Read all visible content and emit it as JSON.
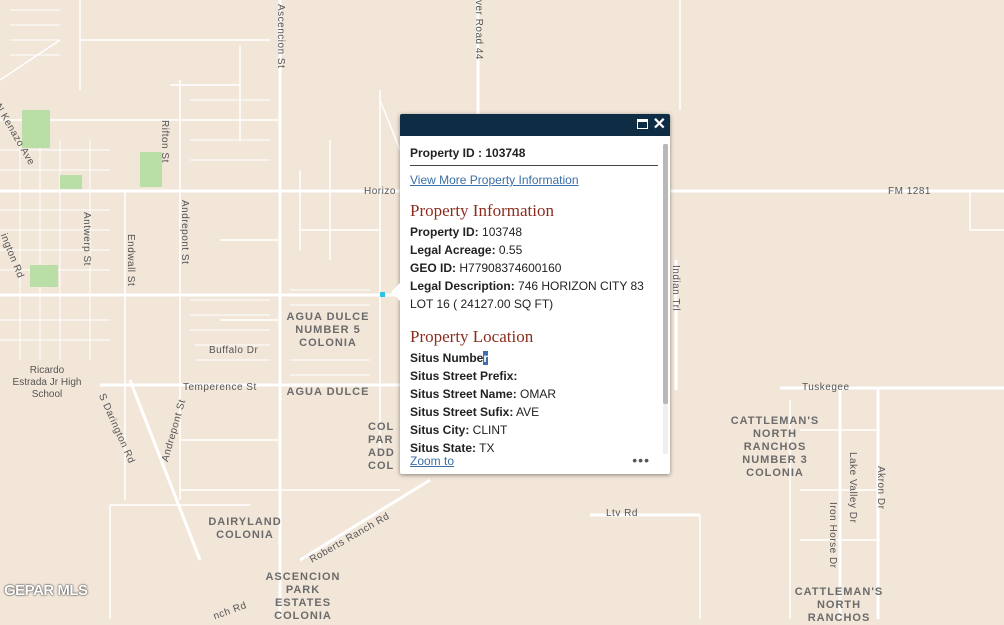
{
  "map": {
    "road_labels": {
      "ascencion_st": "Ascencion St",
      "river_road": "ver Road 44",
      "n_kenazo": "N Kenazo Ave",
      "rifton": "Rifton St",
      "horizon": "Horizo",
      "fm1281": "FM 1281",
      "antwerp": "Antwerp St",
      "endwall": "Endwall St",
      "andrepont": "Andrepont St",
      "darington_rd": "ington Rd",
      "buffalo": "Buffalo Dr",
      "temperence": "Temperence St",
      "s_darington": "S Darington Rd",
      "andrepont2": "Andrepont St",
      "indian": "Indian Trl",
      "tuskegee": "Tuskegee",
      "ltv": "Ltv Rd",
      "roberts": "Roberts Ranch Rd",
      "lake_valley": "Lake Valley Dr",
      "akron": "Akron Dr",
      "iron_horse": "Iron Horse Dr",
      "bottom_rd": "nch Rd"
    },
    "area_labels": {
      "agua_dulce5": "AGUA DULCE\nNUMBER 5\nCOLONIA",
      "agua_dulce": "AGUA DULCE",
      "school": "Ricardo\nEstrada Jr High\nSchool",
      "cattleman3": "CATTLEMAN'S\nNORTH\nRANCHOS\nNUMBER 3\nCOLONIA",
      "dairyland": "DAIRYLAND\nCOLONIA",
      "ascencion_park": "ASCENCION\nPARK\nESTATES\nCOLONIA",
      "cattleman_n": "CATTLEMAN'S\nNORTH\nRANCHOS",
      "partial": "COL\nPAR\nADD\nCOL"
    },
    "watermark": "GEPAR MLS"
  },
  "popup": {
    "title": "Property ID : 103748",
    "more_link": "View More Property Information",
    "info_section": {
      "heading": "Property Information",
      "rows": [
        {
          "label": "Property ID:",
          "value": " 103748"
        },
        {
          "label": "Legal Acreage:",
          "value": " 0.55"
        },
        {
          "label": "GEO ID:",
          "value": " H77908374600160"
        },
        {
          "label": "Legal Description:",
          "value": " 746 HORIZON CITY 83 LOT 16 ( 24127.00 SQ FT)"
        }
      ]
    },
    "location_section": {
      "heading": "Property Location",
      "situs_number_label": "Situs Numbe",
      "situs_number_sel": "r",
      "rows": [
        {
          "label": "Situs Street Prefix:",
          "value": ""
        },
        {
          "label": "Situs Street Name:",
          "value": " OMAR"
        },
        {
          "label": "Situs Street Sufix:",
          "value": " AVE"
        },
        {
          "label": "Situs City:",
          "value": " CLINT"
        },
        {
          "label": "Situs State:",
          "value": " TX"
        }
      ]
    },
    "zoom_link": "Zoom to",
    "more_menu": "•••",
    "close_glyph": "✕"
  },
  "colors": {
    "header": "#0e2d44",
    "section_heading": "#8b2d1e",
    "link": "#3a6ea5",
    "land": "#f2e6d9",
    "park": "#b9dfa6",
    "marker": "#2ec4e6"
  }
}
